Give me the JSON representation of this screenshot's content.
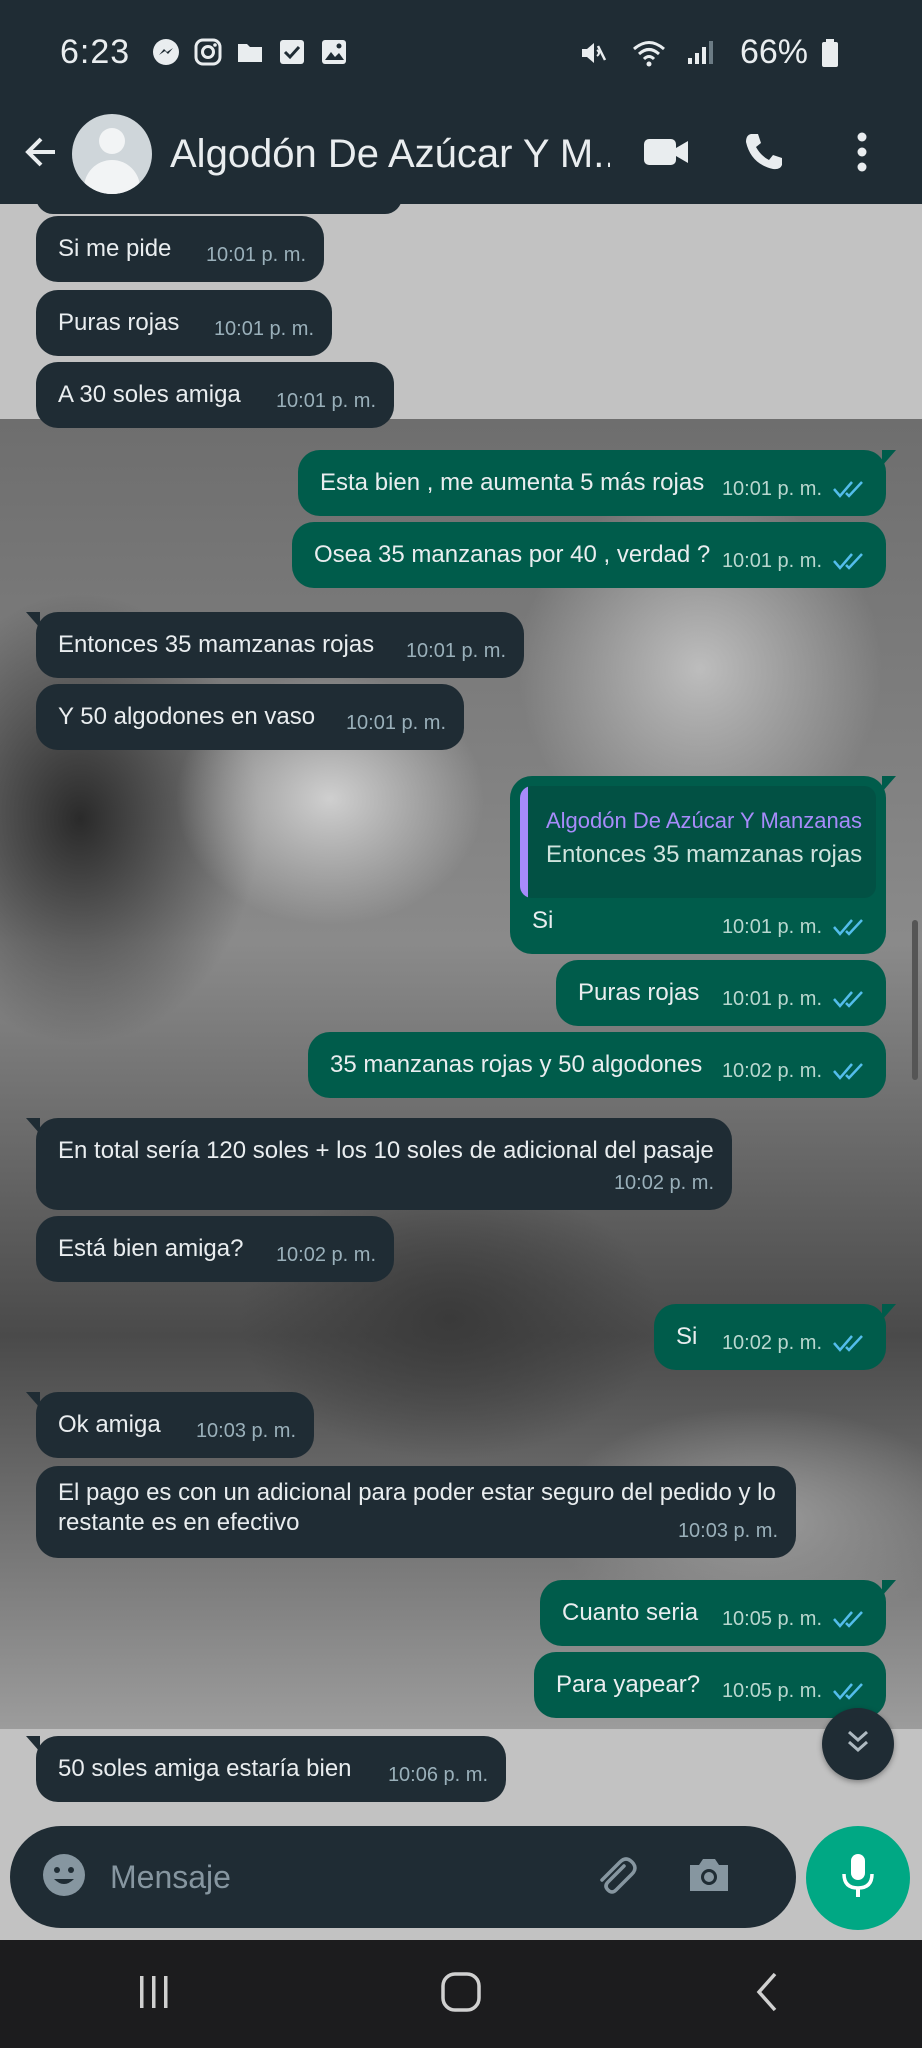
{
  "status_bar": {
    "time": "6:23",
    "battery": "66%"
  },
  "header": {
    "contact_name": "Algodón De Azúcar Y M..."
  },
  "messages": [
    {
      "text": "Si me pide",
      "time": "10:01 p. m.",
      "dir": "in"
    },
    {
      "text": "Puras rojas",
      "time": "10:01 p. m.",
      "dir": "in"
    },
    {
      "text": "A 30 soles amiga",
      "time": "10:01 p. m.",
      "dir": "in"
    },
    {
      "text": "Esta bien , me aumenta 5 más rojas",
      "time": "10:01 p. m.",
      "dir": "out"
    },
    {
      "text": "Osea 35 manzanas por 40 , verdad ?",
      "time": "10:01 p. m.",
      "dir": "out"
    },
    {
      "text": "Entonces 35 mamzanas rojas",
      "time": "10:01 p. m.",
      "dir": "in"
    },
    {
      "text": "Y 50 algodones en vaso",
      "time": "10:01 p. m.",
      "dir": "in"
    },
    {
      "text": "Si",
      "time": "10:01 p. m.",
      "dir": "out",
      "quote_name": "Algodón De Azúcar Y Manzanas",
      "quote_text": "Entonces 35 mamzanas rojas"
    },
    {
      "text": "Puras rojas",
      "time": "10:01 p. m.",
      "dir": "out"
    },
    {
      "text": "35 manzanas rojas y 50 algodones",
      "time": "10:02 p. m.",
      "dir": "out"
    },
    {
      "text": "En total sería 120 soles + los 10 soles de adicional del pasaje",
      "time": "10:02 p. m.",
      "dir": "in"
    },
    {
      "text": "Está bien amiga?",
      "time": "10:02 p. m.",
      "dir": "in"
    },
    {
      "text": "Si",
      "time": "10:02 p. m.",
      "dir": "out"
    },
    {
      "text": "Ok amiga",
      "time": "10:03 p. m.",
      "dir": "in"
    },
    {
      "text_line1": "El pago es con un adicional para poder estar seguro del pedido y lo",
      "text_line2": "restante es en efectivo",
      "time": "10:03 p. m.",
      "dir": "in"
    },
    {
      "text": "Cuanto seria",
      "time": "10:05 p. m.",
      "dir": "out"
    },
    {
      "text": "Para yapear?",
      "time": "10:05 p. m.",
      "dir": "out"
    },
    {
      "text": "50 soles amiga estaría bien",
      "time": "10:06 p. m.",
      "dir": "in"
    }
  ],
  "composer": {
    "placeholder": "Mensaje"
  },
  "colors": {
    "incoming": "#1f2c34",
    "outgoing": "#005c4b",
    "accent": "#00a884",
    "read_ticks": "#53bdeb"
  },
  "icons": [
    "messenger-icon",
    "instagram-icon",
    "folder-icon",
    "checkbox-icon",
    "gallery-icon",
    "mute-icon",
    "wifi-icon",
    "signal-icon",
    "battery-icon",
    "back-arrow-icon",
    "video-call-icon",
    "phone-icon",
    "more-options-icon",
    "emoji-icon",
    "attach-icon",
    "camera-icon",
    "mic-icon",
    "double-chevron-down-icon",
    "recents-icon",
    "home-icon",
    "nav-back-icon"
  ]
}
